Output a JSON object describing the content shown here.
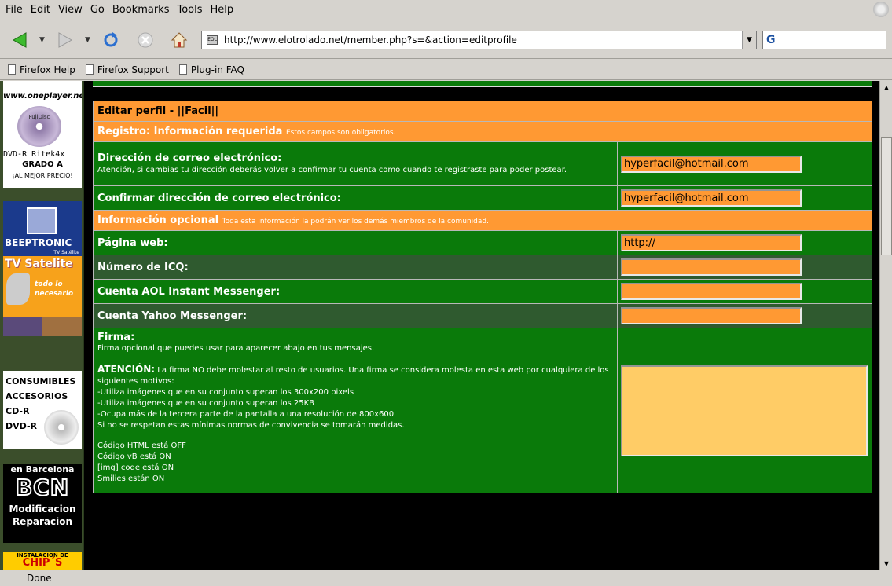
{
  "menu": [
    "File",
    "Edit",
    "View",
    "Go",
    "Bookmarks",
    "Tools",
    "Help"
  ],
  "nav": {
    "url": "http://www.elotrolado.net/member.php?s=&action=editprofile",
    "site_icon_text": "EOL"
  },
  "bookmarks": [
    "Firefox Help",
    "Firefox Support",
    "Plug-in FAQ"
  ],
  "sidebar_ads": {
    "oneplayer_url": "www.oneplayer.net",
    "disc_label": "FujiDisc",
    "dvd_text": "DVD-R Ritek4x",
    "grade": "GRADO A",
    "best_price": "¡AL MEJOR PRECIO!",
    "beeptronic": "BEEPTRONIC",
    "tv_satelite_sub": "TV Satélite",
    "tv_satelite": "TV Satelite",
    "todo": "todo lo necesario",
    "consumibles": "CONSUMIBLES",
    "accesorios": "ACCESORIOS",
    "cdr": "CD-R",
    "dvdr": "DVD-R",
    "barcelona": "en Barcelona",
    "bcn": "BCN",
    "modificacion": "Modificacion",
    "reparacion": "Reparacion",
    "instalacion": "INSTALACION DE",
    "chips": "CHIP´S"
  },
  "form": {
    "title": "Editar perfil - ||Facil||",
    "required_section": "Registro: Información requerida",
    "required_note": "Estos campos son obligatorios.",
    "email_label": "Dirección de correo electrónico:",
    "email_desc": "Atención, si cambias tu dirección deberás volver a confirmar tu cuenta como cuando te registraste para poder postear.",
    "email_value": "hyperfacil@hotmail.com",
    "confirm_email_label": "Confirmar dirección de correo electrónico:",
    "confirm_email_value": "hyperfacil@hotmail.com",
    "optional_section": "Información opcional",
    "optional_note": "Toda esta información la podrán ver los demás miembros de la comunidad.",
    "web_label": "Página web:",
    "web_value": "http://",
    "icq_label": "Número de ICQ:",
    "aol_label": "Cuenta AOL Instant Messenger:",
    "yahoo_label": "Cuenta Yahoo Messenger:",
    "sig_label": "Firma:",
    "sig_desc": "Firma opcional que puedes usar para aparecer abajo en tus mensajes.",
    "sig_warning_title": "ATENCIÓN:",
    "sig_warning": "La firma NO debe molestar al resto de usuarios. Una firma se considera molesta en esta web por cualquiera de los siguientes motivos:",
    "sig_rule1": "-Utiliza imágenes que en su conjunto superan los 300x200 pixels",
    "sig_rule2": "-Utiliza imágenes que en su conjunto superan los 25KB",
    "sig_rule3": "-Ocupa más de la tercera parte de la pantalla a una resolución de 800x600",
    "sig_rule4": "Si no se respetan estas mínimas normas de convivencia se tomarán medidas.",
    "html_code": "Código HTML está OFF",
    "vb_code_link": "Código vB",
    "vb_code_state": "está ON",
    "img_code": "[img] code está ON",
    "smilies_link": "Smilies",
    "smilies_state": "están ON"
  },
  "status": "Done"
}
